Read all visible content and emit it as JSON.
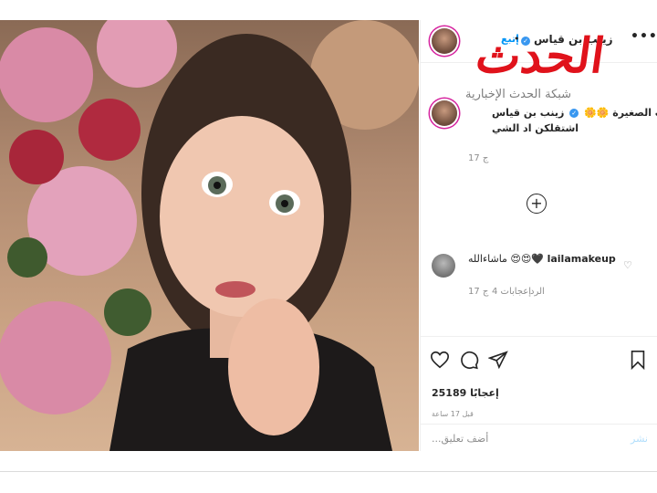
{
  "post": {
    "username": "زينب بن قياس",
    "follow_label": "إتبع",
    "more_label": "•••"
  },
  "watermark": {
    "title": "الحدث",
    "subtitle": "شبكة الحدث الإخبارية"
  },
  "caption": {
    "username": "زينب بن قياس",
    "line1": "زينب الصغيرة 🌼🌼",
    "line2": "اشتقلكن اد الشي",
    "time": "17 ج"
  },
  "load_more_label": "+",
  "comment": {
    "username": "lailamakeup",
    "text": "ماشاءالله 😍😍🖤",
    "time": "17 ج",
    "likes": "4 إعجابات",
    "reply": "الرد"
  },
  "actions": {
    "likes_count": "25189",
    "likes_label": "إعجابًا",
    "timestamp": "قبل 17 ساعة"
  },
  "add_comment": {
    "placeholder": "...أضف تعليق",
    "post_label": "نشر"
  },
  "colors": {
    "accent": "#0095f6",
    "verified": "#3897f0",
    "watermark_red": "#e0121b"
  }
}
